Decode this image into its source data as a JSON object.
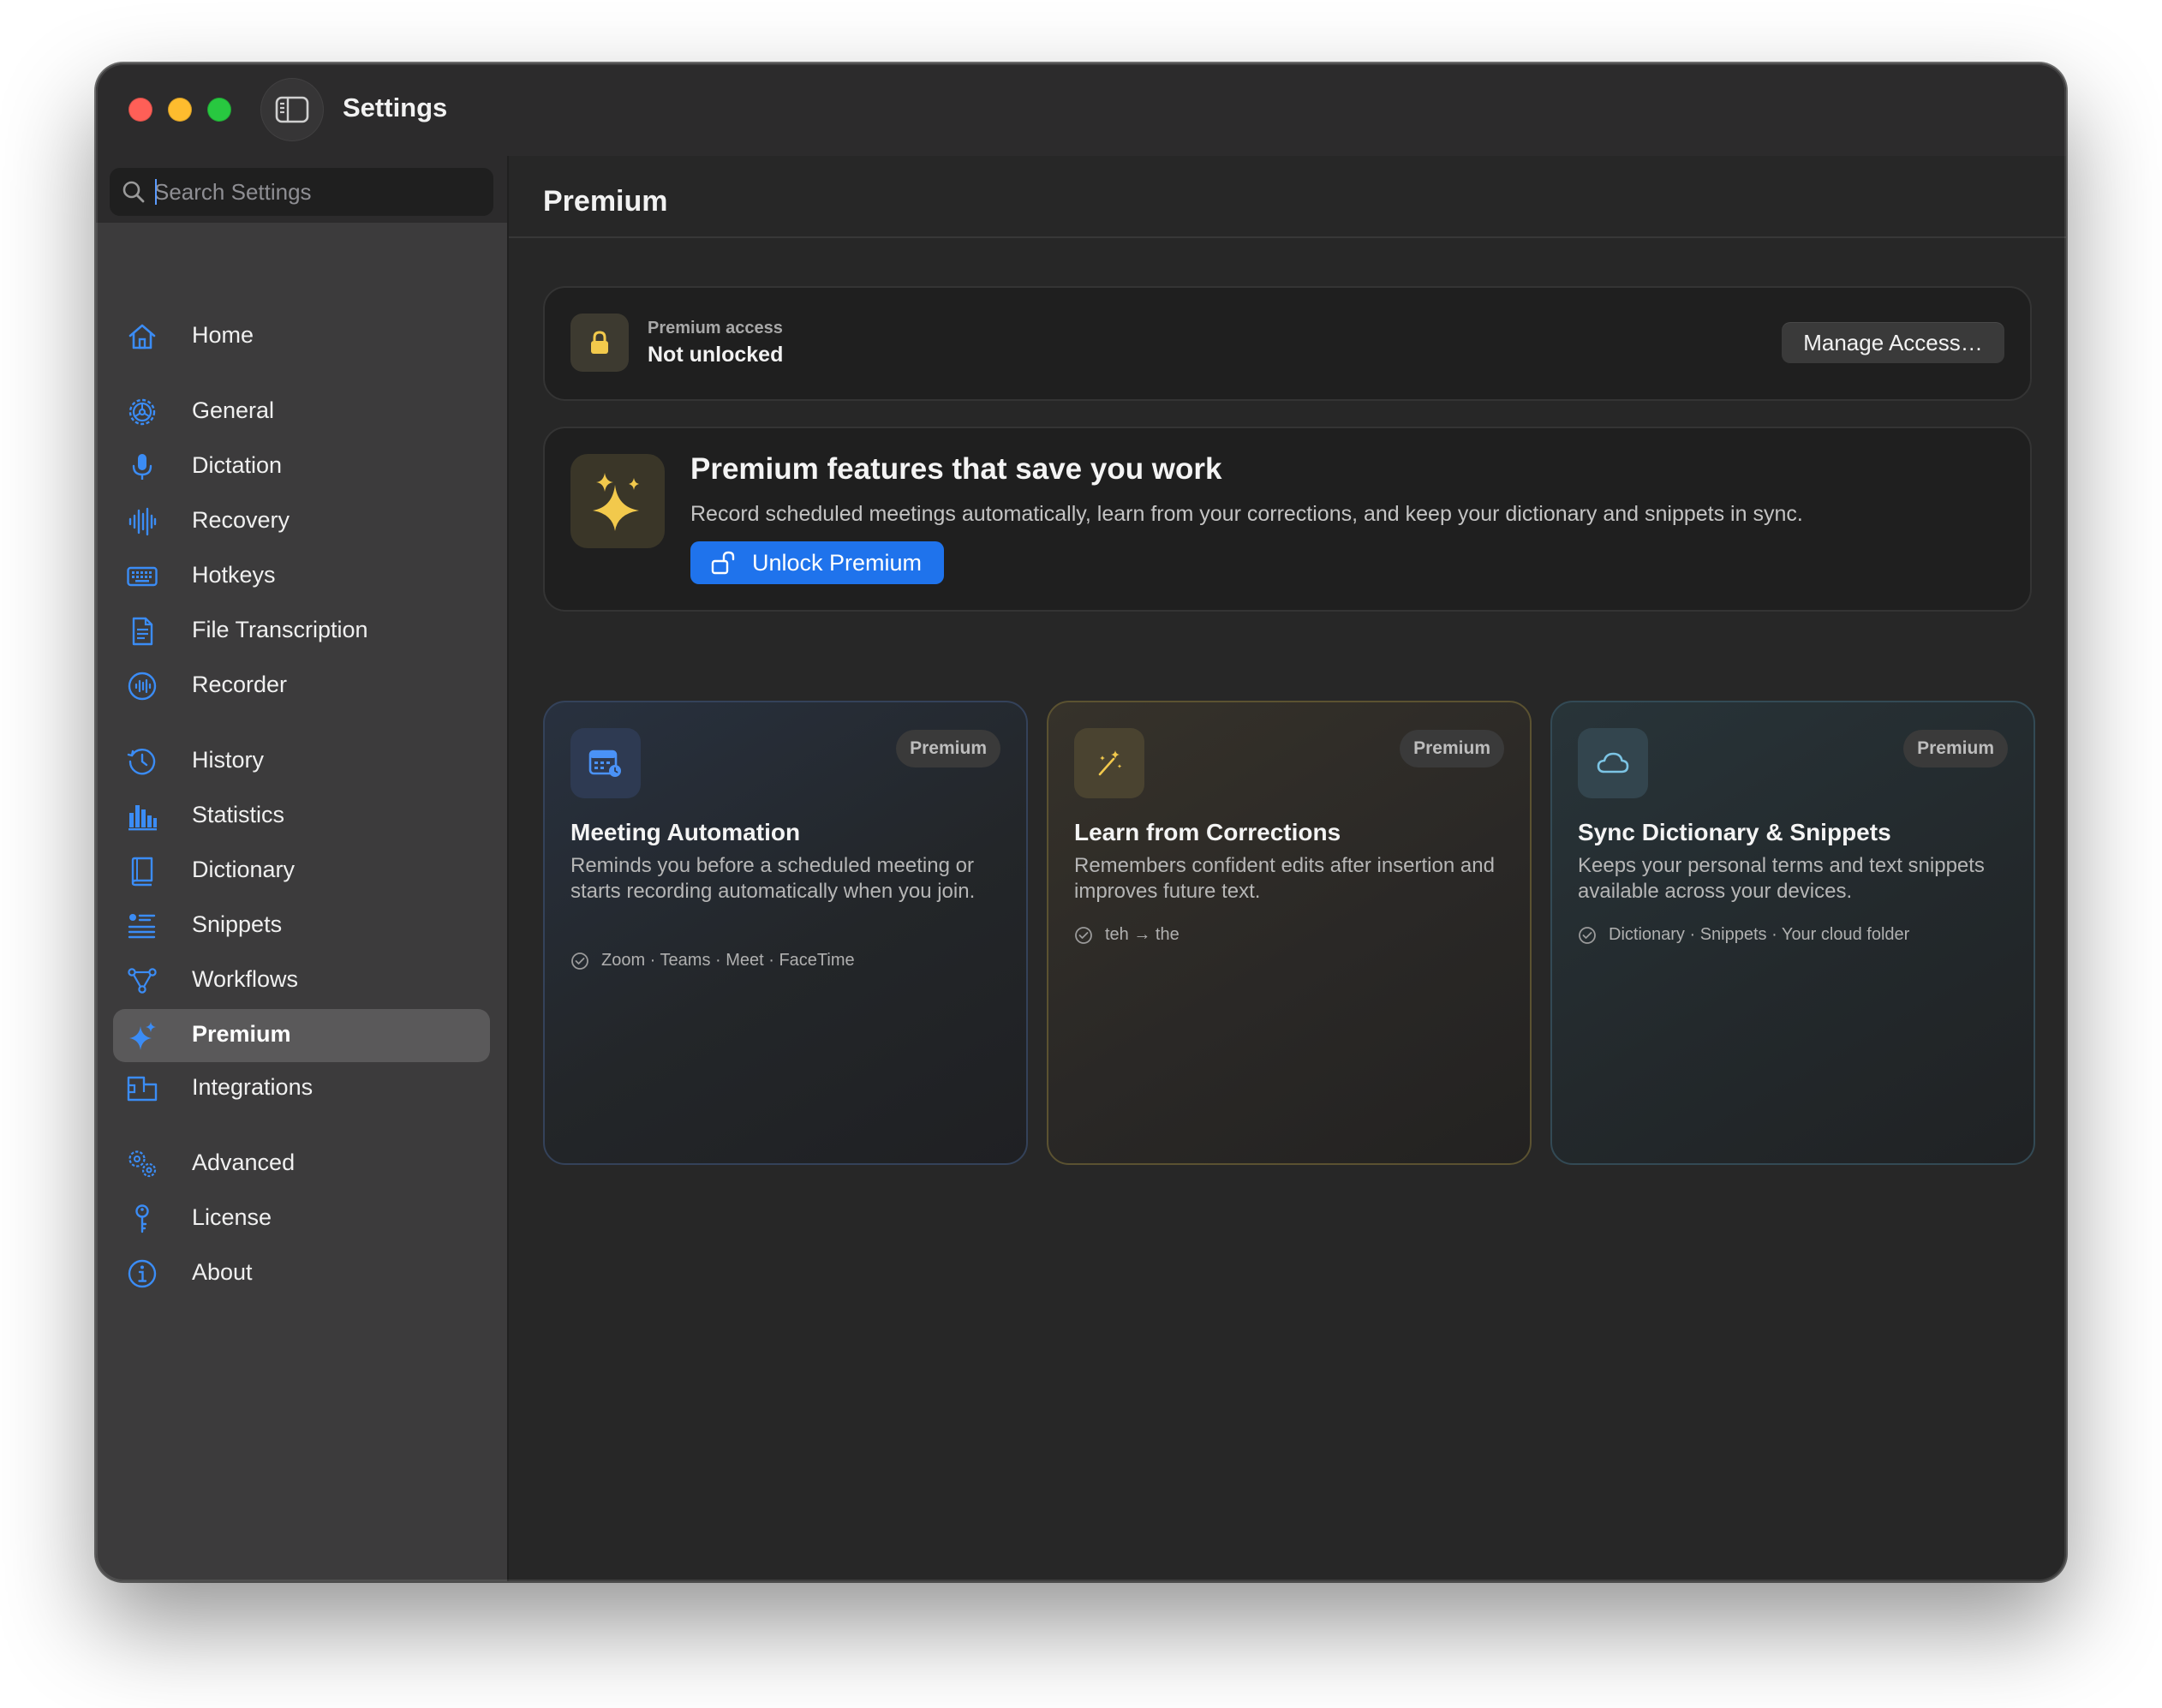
{
  "window": {
    "title": "Settings"
  },
  "search": {
    "placeholder": "Search Settings",
    "value": ""
  },
  "sidebar": {
    "items": [
      {
        "label": "Home",
        "icon": "house-icon"
      },
      {
        "label": "General",
        "icon": "gear-icon"
      },
      {
        "label": "Dictation",
        "icon": "microphone-icon"
      },
      {
        "label": "Recovery",
        "icon": "waveform-icon"
      },
      {
        "label": "Hotkeys",
        "icon": "keyboard-icon"
      },
      {
        "label": "File Transcription",
        "icon": "document-icon"
      },
      {
        "label": "Recorder",
        "icon": "recorder-icon"
      },
      {
        "label": "History",
        "icon": "clock-history-icon"
      },
      {
        "label": "Statistics",
        "icon": "bar-chart-icon"
      },
      {
        "label": "Dictionary",
        "icon": "book-icon"
      },
      {
        "label": "Snippets",
        "icon": "snippets-list-icon"
      },
      {
        "label": "Workflows",
        "icon": "workflow-nodes-icon"
      },
      {
        "label": "Premium",
        "icon": "sparkle-icon",
        "active": true
      },
      {
        "label": "Integrations",
        "icon": "plug-icon"
      },
      {
        "label": "Advanced",
        "icon": "gears-icon"
      },
      {
        "label": "License",
        "icon": "key-icon"
      },
      {
        "label": "About",
        "icon": "info-icon"
      }
    ]
  },
  "main": {
    "title": "Premium",
    "access": {
      "label": "Premium access",
      "status": "Not unlocked",
      "manage_button": "Manage Access…"
    },
    "hero": {
      "title": "Premium features that save you work",
      "description": "Record scheduled meetings automatically, learn from your corrections, and keep your dictionary and snippets in sync.",
      "unlock_button": "Unlock Premium"
    },
    "features": [
      {
        "badge": "Premium",
        "title": "Meeting Automation",
        "description": "Reminds you before a scheduled meeting or starts recording automatically when you join.",
        "meta": "Zoom · Teams · Meet · FaceTime",
        "icon": "calendar-icon"
      },
      {
        "badge": "Premium",
        "title": "Learn from Corrections",
        "description": "Remembers confident edits after insertion and improves future text.",
        "meta": "teh → the",
        "icon": "magic-wand-icon"
      },
      {
        "badge": "Premium",
        "title": "Sync Dictionary & Snippets",
        "description": "Keeps your personal terms and text snippets available across your devices.",
        "meta": "Dictionary · Snippets · Your cloud folder",
        "icon": "cloud-icon"
      }
    ]
  },
  "colors": {
    "accent": "#1f73ec",
    "icon_blue": "#3b8cf5",
    "gold": "#f2c94c",
    "window_bg": "#272727",
    "sidebar_bg": "#3c3b3c"
  }
}
